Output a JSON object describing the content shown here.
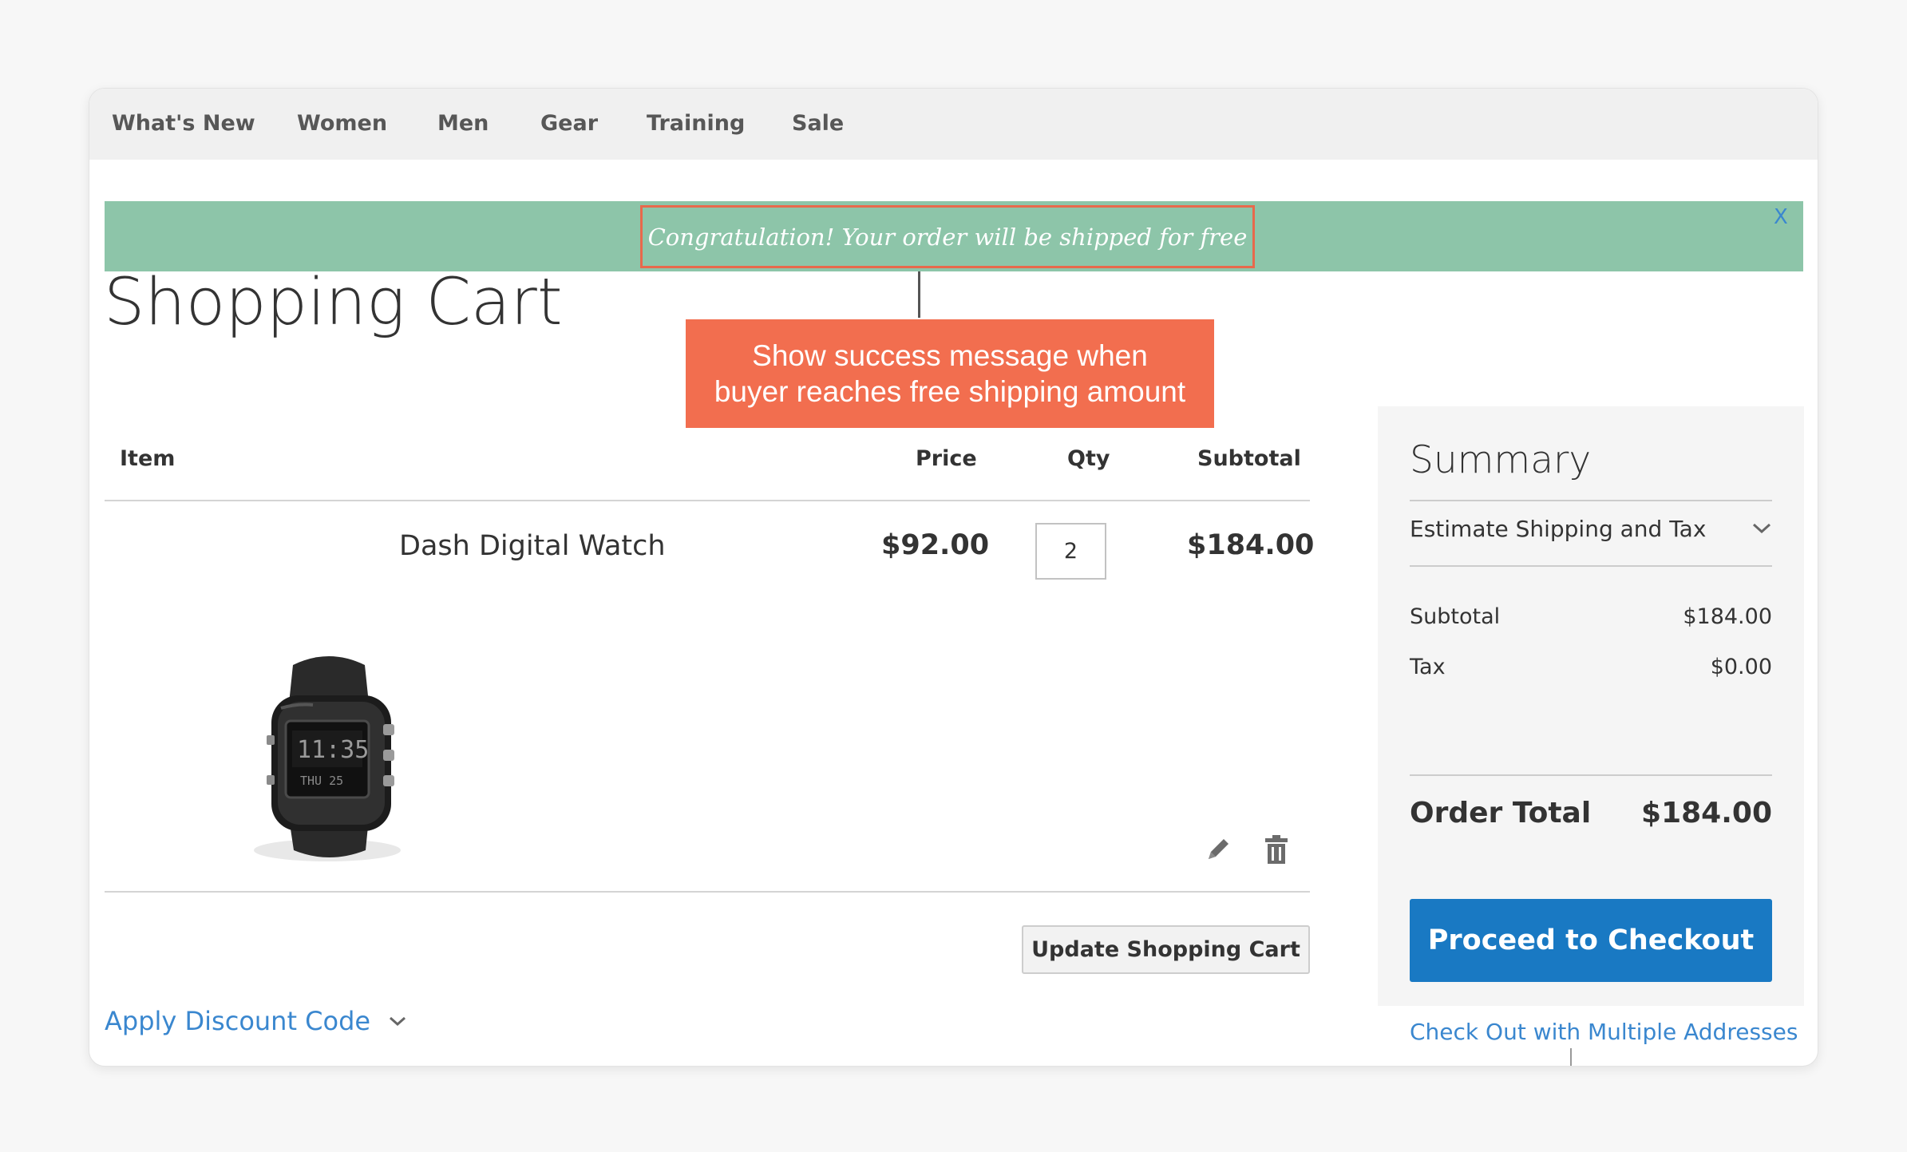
{
  "nav": {
    "items": [
      "What's New",
      "Women",
      "Men",
      "Gear",
      "Training",
      "Sale"
    ]
  },
  "banner": {
    "message": "Congratulation! Your order will be shipped for free",
    "close": "X"
  },
  "callout": {
    "line1": "Show success message when",
    "line2": "buyer reaches free shipping amount"
  },
  "page": {
    "title": "Shopping Cart"
  },
  "cart": {
    "columns": {
      "item": "Item",
      "price": "Price",
      "qty": "Qty",
      "subtotal": "Subtotal"
    },
    "items": [
      {
        "name": "Dash Digital Watch",
        "price": "$92.00",
        "qty": "2",
        "subtotal": "$184.00",
        "image_icon": "watch-image"
      }
    ],
    "update_label": "Update Shopping Cart",
    "discount_label": "Apply Discount Code",
    "icons": {
      "edit": "pencil-icon",
      "delete": "trash-icon",
      "expand": "chevron-down-icon"
    }
  },
  "summary": {
    "title": "Summary",
    "estimate_label": "Estimate Shipping and Tax",
    "subtotal_label": "Subtotal",
    "subtotal_value": "$184.00",
    "tax_label": "Tax",
    "tax_value": "$0.00",
    "total_label": "Order Total",
    "total_value": "$184.00",
    "checkout_label": "Proceed to Checkout",
    "multi_label": "Check Out with Multiple Addresses"
  },
  "colors": {
    "banner": "#8dc5a9",
    "callout": "#f26e4f",
    "highlight_border": "#e8694c",
    "primary_button": "#1979c3",
    "link": "#3a87cf",
    "nav_background": "#f0f0f0",
    "summary_background": "#f5f5f5"
  }
}
